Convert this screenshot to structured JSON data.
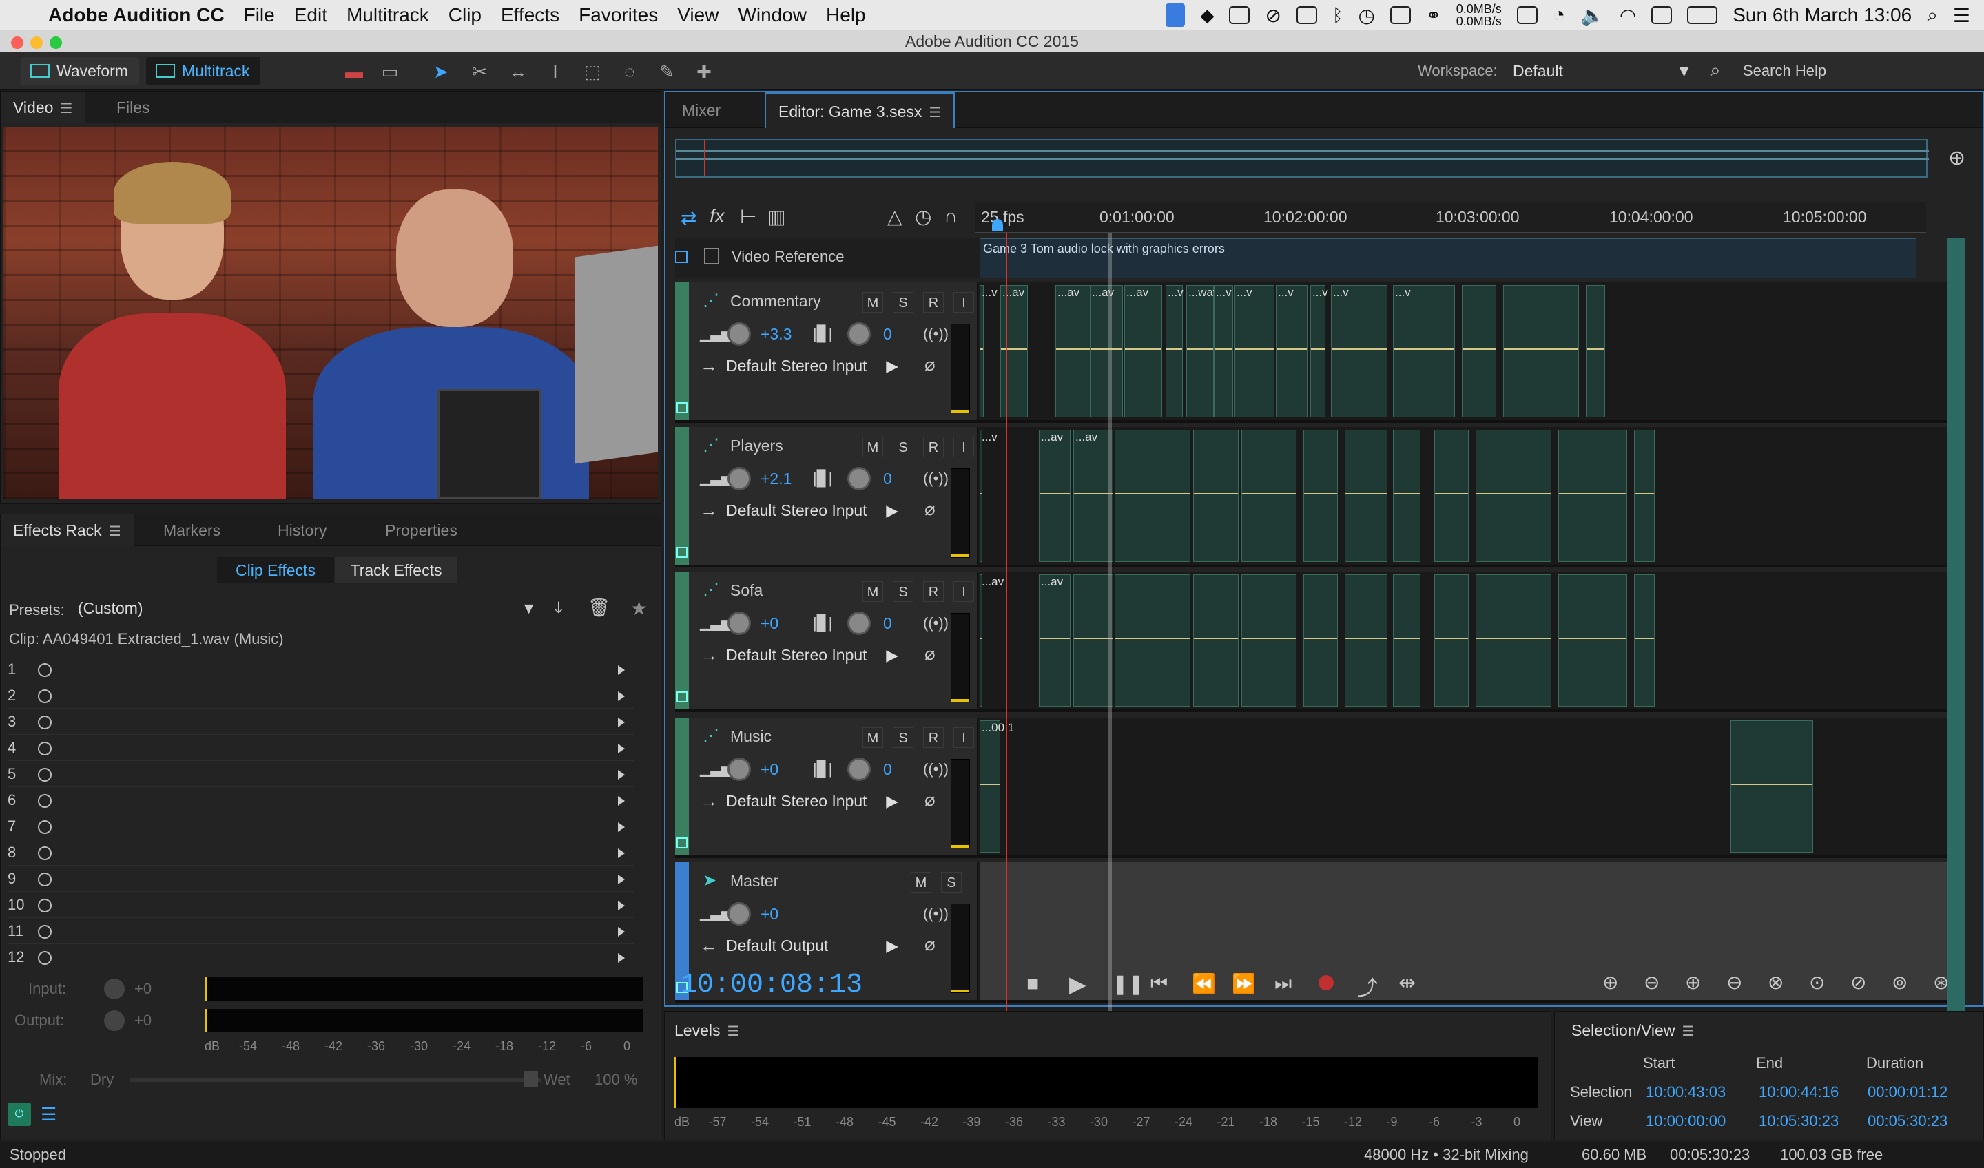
{
  "menubar": {
    "app_name": "Adobe Audition CC",
    "items": [
      "File",
      "Edit",
      "Multitrack",
      "Clip",
      "Effects",
      "Favorites",
      "View",
      "Window",
      "Help"
    ],
    "netspeed_up": "0.0MB/s",
    "netspeed_down": "0.0MB/s",
    "clock": "Sun 6th March  13:06"
  },
  "window_title": "Adobe Audition CC 2015",
  "toolbar": {
    "waveform_label": "Waveform",
    "multitrack_label": "Multitrack",
    "workspace_label": "Workspace:",
    "workspace_value": "Default",
    "search_help": "Search Help"
  },
  "video_panel": {
    "tabs": [
      "Video",
      "Files"
    ]
  },
  "effects_panel": {
    "tabs": [
      "Effects Rack",
      "Markers",
      "History",
      "Properties"
    ],
    "clip_effects": "Clip Effects",
    "track_effects": "Track Effects",
    "presets_label": "Presets:",
    "presets_value": "(Custom)",
    "clip_name": "Clip: AA049401 Extracted_1.wav (Music)",
    "slots": [
      "1",
      "2",
      "3",
      "4",
      "5",
      "6",
      "7",
      "8",
      "9",
      "10",
      "11",
      "12"
    ],
    "input_label": "Input:",
    "input_value": "+0",
    "output_label": "Output:",
    "output_value": "+0",
    "db_scale": [
      "dB",
      "-54",
      "-48",
      "-42",
      "-36",
      "-30",
      "-24",
      "-18",
      "-12",
      "-6",
      "0"
    ],
    "mix_label": "Mix:",
    "dry_label": "Dry",
    "wet_label": "Wet",
    "wet_value": "100 %"
  },
  "editor": {
    "tabs": [
      "Mixer",
      "Editor: Game 3.sesx"
    ],
    "fps": "25 fps",
    "ruler": [
      "0:01:00:00",
      "10:02:00:00",
      "10:03:00:00",
      "10:04:00:00",
      "10:05:00:00"
    ],
    "video_ref_label": "Video Reference",
    "video_clip_label": "Game 3 Tom audio lock with graphics errors",
    "tracks": [
      {
        "name": "Commentary",
        "volume": "+3.3",
        "pan": "0",
        "input": "Default Stereo Input",
        "clip_labels": [
          "...v",
          "...av",
          "...av",
          "...av",
          "...av",
          "...v",
          "...wav",
          "...v",
          "...v",
          "...v",
          "...v",
          "...v",
          "...v"
        ]
      },
      {
        "name": "Players",
        "volume": "+2.1",
        "pan": "0",
        "input": "Default Stereo Input",
        "clip_labels": [
          "...v",
          "...av",
          "...av"
        ]
      },
      {
        "name": "Sofa",
        "volume": "+0",
        "pan": "0",
        "input": "Default Stereo Input",
        "clip_labels": [
          "...av",
          "...av"
        ]
      },
      {
        "name": "Music",
        "volume": "+0",
        "pan": "0",
        "input": "Default Stereo Input",
        "clip_labels": [
          "...00 1"
        ]
      },
      {
        "name": "Master",
        "volume": "+0",
        "output": "Default Output"
      }
    ],
    "msri": [
      "M",
      "S",
      "R",
      "I"
    ],
    "timecode": "10:00:08:13"
  },
  "levels": {
    "title": "Levels",
    "scale": [
      "dB",
      "-57",
      "-54",
      "-51",
      "-48",
      "-45",
      "-42",
      "-39",
      "-36",
      "-33",
      "-30",
      "-27",
      "-24",
      "-21",
      "-18",
      "-15",
      "-12",
      "-9",
      "-6",
      "-3",
      "0"
    ]
  },
  "selection_view": {
    "title": "Selection/View",
    "headers": [
      "Start",
      "End",
      "Duration"
    ],
    "selection_label": "Selection",
    "selection": [
      "10:00:43:03",
      "10:00:44:16",
      "00:00:01:12"
    ],
    "view_label": "View",
    "view": [
      "10:00:00:00",
      "10:05:30:23",
      "00:05:30:23"
    ]
  },
  "statusbar": {
    "state": "Stopped",
    "format": "48000 Hz • 32-bit Mixing",
    "memory": "60.60 MB",
    "duration": "00:05:30:23",
    "free": "100.03 GB free"
  },
  "colors": {
    "accent": "#3ea7ff",
    "clip_green": "#1f3a34",
    "playhead": "#e0302a"
  }
}
